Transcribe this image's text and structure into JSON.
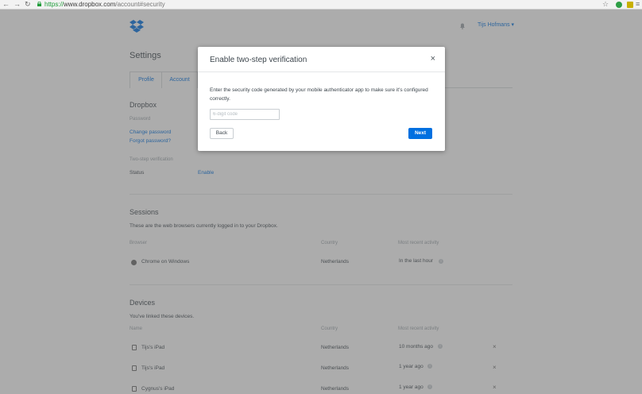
{
  "browser": {
    "url_scheme": "https://",
    "url_host": "www.dropbox.com",
    "url_path": "/account#security"
  },
  "header": {
    "user_name": "Tijs Hofmans ▾"
  },
  "settings": {
    "title": "Settings",
    "tabs": [
      "Profile",
      "Account"
    ]
  },
  "dropbox_section": {
    "title": "Dropbox",
    "password_label": "Password",
    "change_password": "Change password",
    "forgot_password": "Forgot password?",
    "two_step_label": "Two-step verification",
    "status_label": "Status",
    "status_value": "Enable"
  },
  "sessions": {
    "title": "Sessions",
    "description": "These are the web browsers currently logged in to your Dropbox.",
    "headers": [
      "Browser",
      "Country",
      "Most recent activity"
    ],
    "rows": [
      {
        "browser": "Chrome on Windows",
        "country": "Netherlands",
        "activity": "In the last hour"
      }
    ]
  },
  "devices": {
    "title": "Devices",
    "description": "You've linked these devices.",
    "headers": [
      "Name",
      "Country",
      "Most recent activity"
    ],
    "rows": [
      {
        "name": "Tijs's iPad",
        "country": "Netherlands",
        "activity": "10 months ago"
      },
      {
        "name": "Tijs's iPad",
        "country": "Netherlands",
        "activity": "1 year ago"
      },
      {
        "name": "Cygnus's iPad",
        "country": "Netherlands",
        "activity": "1 year ago"
      }
    ]
  },
  "modal": {
    "title": "Enable two-step verification",
    "close": "×",
    "body": "Enter the security code generated by your mobile authenticator app to make sure it's configured correctly.",
    "input_placeholder": "6-digit code",
    "back_label": "Back",
    "next_label": "Next"
  },
  "colors": {
    "accent": "#0070e0",
    "overlay": "#5a5a5a"
  }
}
